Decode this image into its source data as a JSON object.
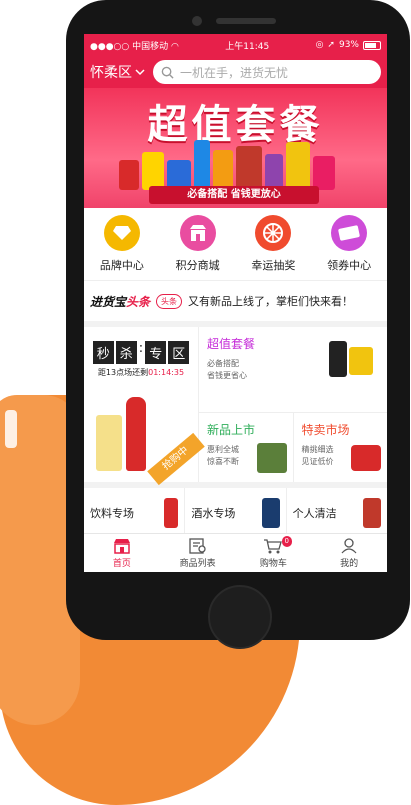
{
  "status": {
    "carrier": "中国移动",
    "time": "上午11:45",
    "battery": "93%"
  },
  "header": {
    "location": "怀柔区",
    "search_placeholder": "一机在手，进货无忧"
  },
  "banner": {
    "title": "超值套餐",
    "ribbon": "必备搭配 省钱更放心"
  },
  "icons": [
    {
      "label": "品牌中心",
      "color": "#f5b800"
    },
    {
      "label": "积分商城",
      "color": "#e94da0"
    },
    {
      "label": "幸运抽奖",
      "color": "#f04b2e"
    },
    {
      "label": "领券中心",
      "color": "#ce4cd8"
    }
  ],
  "news": {
    "logo_a": "进货宝",
    "logo_b": "头条",
    "tag": "头条",
    "text": "又有新品上线了，掌柜们快来看！"
  },
  "flash": {
    "c1": "秒",
    "c2": "杀",
    "c3": "专",
    "c4": "区",
    "countdown_label": "距13点场还剩",
    "countdown": "01:14:35",
    "badge": "抢购中"
  },
  "deal": {
    "title": "超值套餐",
    "line1": "必备搭配",
    "line2": "省钱更省心"
  },
  "new_items": {
    "title": "新品上市",
    "line1": "惠利全城",
    "line2": "惊喜不断"
  },
  "special": {
    "title": "特卖市场",
    "line1": "精挑细选",
    "line2": "见证低价"
  },
  "categories": [
    "饮料专场",
    "酒水专场",
    "个人清洁"
  ],
  "tabs": [
    {
      "label": "首页"
    },
    {
      "label": "商品列表"
    },
    {
      "label": "购物车",
      "badge": "0"
    },
    {
      "label": "我的"
    }
  ]
}
